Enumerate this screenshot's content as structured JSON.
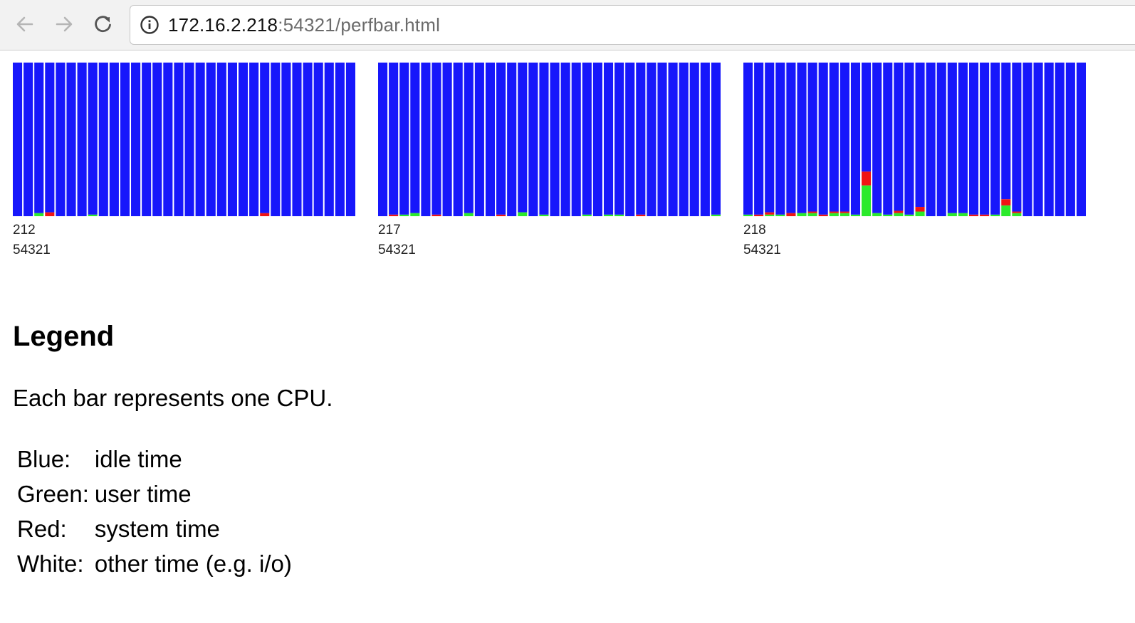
{
  "browser": {
    "url_host": "172.16.2.218",
    "url_rest": ":54321/perfbar.html"
  },
  "colors": {
    "idle": "#1717fb",
    "user": "#2bea2b",
    "system": "#f01414",
    "other": "#ffffff"
  },
  "charts": [
    {
      "host": "212",
      "port": "54321",
      "cpus": [
        {
          "user": 0,
          "system": 0
        },
        {
          "user": 0,
          "system": 0
        },
        {
          "user": 0.02,
          "system": 0
        },
        {
          "user": 0,
          "system": 0.025
        },
        {
          "user": 0,
          "system": 0
        },
        {
          "user": 0,
          "system": 0
        },
        {
          "user": 0,
          "system": 0
        },
        {
          "user": 0.01,
          "system": 0
        },
        {
          "user": 0,
          "system": 0
        },
        {
          "user": 0,
          "system": 0
        },
        {
          "user": 0,
          "system": 0
        },
        {
          "user": 0,
          "system": 0
        },
        {
          "user": 0,
          "system": 0
        },
        {
          "user": 0,
          "system": 0
        },
        {
          "user": 0,
          "system": 0
        },
        {
          "user": 0,
          "system": 0
        },
        {
          "user": 0,
          "system": 0
        },
        {
          "user": 0,
          "system": 0
        },
        {
          "user": 0,
          "system": 0
        },
        {
          "user": 0,
          "system": 0
        },
        {
          "user": 0,
          "system": 0
        },
        {
          "user": 0,
          "system": 0
        },
        {
          "user": 0,
          "system": 0
        },
        {
          "user": 0,
          "system": 0.02
        },
        {
          "user": 0,
          "system": 0
        },
        {
          "user": 0,
          "system": 0
        },
        {
          "user": 0,
          "system": 0
        },
        {
          "user": 0,
          "system": 0
        },
        {
          "user": 0,
          "system": 0
        },
        {
          "user": 0,
          "system": 0
        },
        {
          "user": 0,
          "system": 0
        },
        {
          "user": 0,
          "system": 0
        }
      ]
    },
    {
      "host": "217",
      "port": "54321",
      "cpus": [
        {
          "user": 0,
          "system": 0
        },
        {
          "user": 0,
          "system": 0.01
        },
        {
          "user": 0.01,
          "system": 0
        },
        {
          "user": 0.02,
          "system": 0
        },
        {
          "user": 0,
          "system": 0
        },
        {
          "user": 0,
          "system": 0.01
        },
        {
          "user": 0,
          "system": 0
        },
        {
          "user": 0,
          "system": 0
        },
        {
          "user": 0.02,
          "system": 0
        },
        {
          "user": 0,
          "system": 0
        },
        {
          "user": 0,
          "system": 0
        },
        {
          "user": 0,
          "system": 0.01
        },
        {
          "user": 0,
          "system": 0
        },
        {
          "user": 0.025,
          "system": 0
        },
        {
          "user": 0,
          "system": 0
        },
        {
          "user": 0.01,
          "system": 0
        },
        {
          "user": 0,
          "system": 0
        },
        {
          "user": 0,
          "system": 0
        },
        {
          "user": 0,
          "system": 0
        },
        {
          "user": 0.01,
          "system": 0
        },
        {
          "user": 0,
          "system": 0
        },
        {
          "user": 0.01,
          "system": 0
        },
        {
          "user": 0.01,
          "system": 0
        },
        {
          "user": 0,
          "system": 0
        },
        {
          "user": 0,
          "system": 0.01
        },
        {
          "user": 0,
          "system": 0
        },
        {
          "user": 0,
          "system": 0
        },
        {
          "user": 0,
          "system": 0
        },
        {
          "user": 0,
          "system": 0
        },
        {
          "user": 0,
          "system": 0
        },
        {
          "user": 0,
          "system": 0
        },
        {
          "user": 0.01,
          "system": 0
        }
      ]
    },
    {
      "host": "218",
      "port": "54321",
      "cpus": [
        {
          "user": 0.01,
          "system": 0
        },
        {
          "user": 0,
          "system": 0.01
        },
        {
          "user": 0.01,
          "system": 0.015
        },
        {
          "user": 0.01,
          "system": 0
        },
        {
          "user": 0,
          "system": 0.02
        },
        {
          "user": 0.02,
          "system": 0
        },
        {
          "user": 0.02,
          "system": 0.01
        },
        {
          "user": 0,
          "system": 0.01
        },
        {
          "user": 0.02,
          "system": 0.01
        },
        {
          "user": 0.02,
          "system": 0.01
        },
        {
          "user": 0.01,
          "system": 0
        },
        {
          "user": 0.2,
          "system": 0.09
        },
        {
          "user": 0.02,
          "system": 0
        },
        {
          "user": 0.01,
          "system": 0
        },
        {
          "user": 0.02,
          "system": 0.015
        },
        {
          "user": 0.01,
          "system": 0
        },
        {
          "user": 0.03,
          "system": 0.03
        },
        {
          "user": 0,
          "system": 0
        },
        {
          "user": 0,
          "system": 0
        },
        {
          "user": 0.02,
          "system": 0
        },
        {
          "user": 0.02,
          "system": 0
        },
        {
          "user": 0,
          "system": 0.01
        },
        {
          "user": 0,
          "system": 0.01
        },
        {
          "user": 0.01,
          "system": 0
        },
        {
          "user": 0.07,
          "system": 0.04
        },
        {
          "user": 0.02,
          "system": 0.01
        },
        {
          "user": 0,
          "system": 0
        },
        {
          "user": 0,
          "system": 0
        },
        {
          "user": 0,
          "system": 0
        },
        {
          "user": 0,
          "system": 0
        },
        {
          "user": 0,
          "system": 0
        },
        {
          "user": 0,
          "system": 0
        }
      ]
    }
  ],
  "legend": {
    "title": "Legend",
    "description": "Each bar represents one CPU.",
    "rows": [
      {
        "name": "Blue:",
        "meaning": "idle time"
      },
      {
        "name": "Green:",
        "meaning": "user time"
      },
      {
        "name": "Red:",
        "meaning": "system time"
      },
      {
        "name": "White:",
        "meaning": "other time (e.g. i/o)"
      }
    ]
  }
}
